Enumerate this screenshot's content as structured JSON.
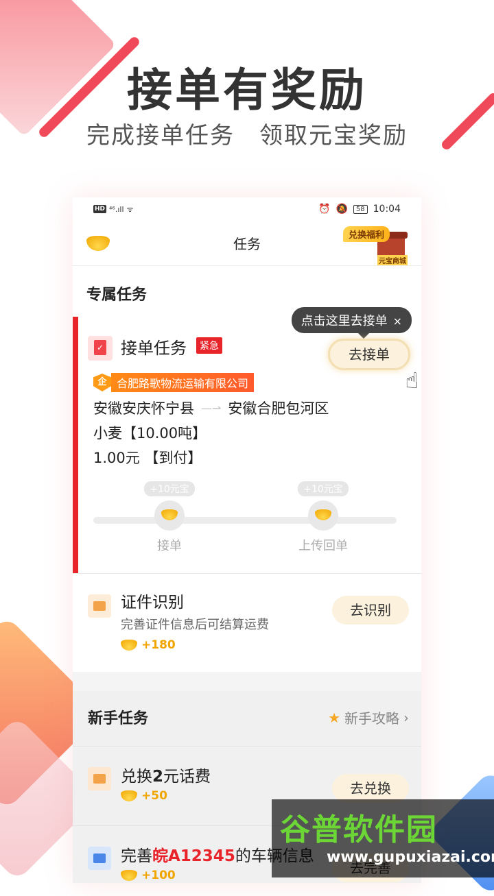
{
  "header": {
    "headline": "接单有奖励",
    "subline": "完成接单任务　领取元宝奖励"
  },
  "statusbar": {
    "network": "HD",
    "signal": "⁴⁶.ıll",
    "wifi": "ᯤ",
    "alarm": "⏰",
    "mute": "🔕",
    "battery": "58",
    "time": "10:04"
  },
  "navbar": {
    "title": "任务",
    "shop_tag": "兑换福利",
    "shop_label": "元宝商城"
  },
  "exclusive": {
    "section_title": "专属任务",
    "order_task": {
      "title": "接单任务",
      "badge": "紧急",
      "button": "去接单",
      "tooltip": "点击这里去接单",
      "tooltip_close": "×",
      "company_mark": "企",
      "company": "合肥路歌物流运输有限公司",
      "from": "安徽安庆怀宁县",
      "to": "安徽合肥包河区",
      "cargo": "小麦【10.00吨】",
      "price": "1.00元 【到付】",
      "steps": [
        {
          "reward": "+10元宝",
          "label": "接单"
        },
        {
          "reward": "+10元宝",
          "label": "上传回单"
        }
      ]
    },
    "id_task": {
      "title": "证件识别",
      "desc": "完善证件信息后可结算运费",
      "reward": "+180",
      "button": "去识别"
    }
  },
  "newbie": {
    "section_title": "新手任务",
    "guide": "新手攻略",
    "items": [
      {
        "title_pre": "兑换",
        "title_bold": "2",
        "title_post": "元话费",
        "reward": "+50",
        "button": "去兑换"
      },
      {
        "title_pre": "完善",
        "plate": "皖A12345",
        "title_post": "的车辆信息",
        "reward": "+100",
        "button": "去完善"
      }
    ]
  },
  "watermark": {
    "top": "谷普软件园",
    "bottom": "www.gupuxiazai.com"
  }
}
